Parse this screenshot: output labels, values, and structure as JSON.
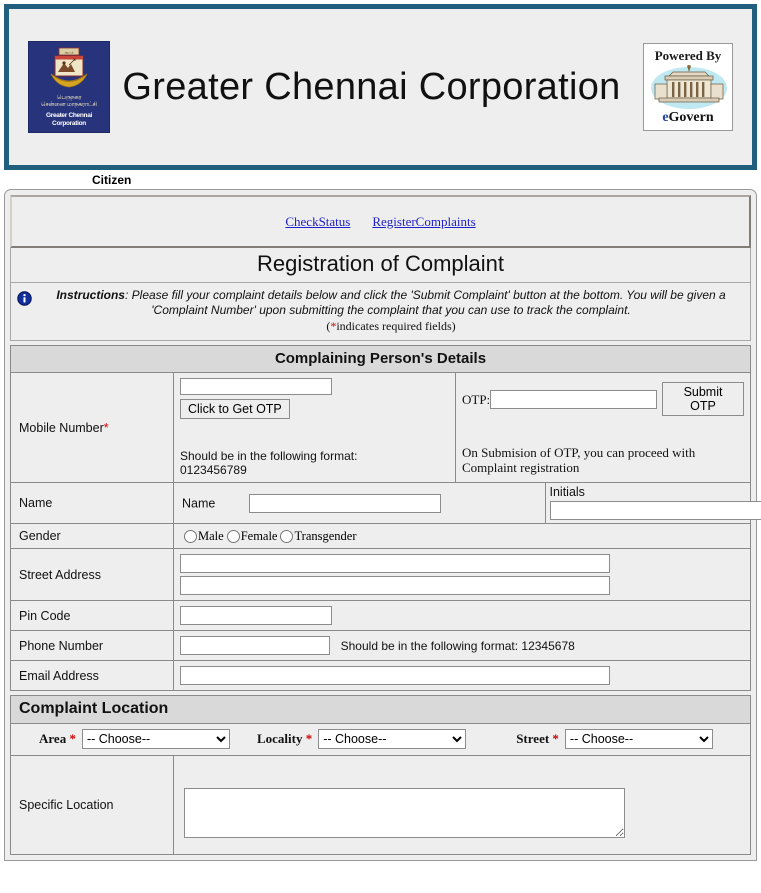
{
  "header": {
    "title": "Greater Chennai Corporation",
    "gcc_logo": {
      "icon": "chennai-corporation-crest",
      "tamil_line1": "பெருநகர",
      "tamil_line2": "சென்னை மாநகராட்சி",
      "english": "Greater Chennai Corporation"
    },
    "egovern_logo": {
      "top_text": "Powered By",
      "icon": "government-building-icon",
      "brand_prefix": "e",
      "brand_suffix": "Govern"
    },
    "accent_color": "#215f7f"
  },
  "citizen_label": "Citizen",
  "nav": {
    "links": [
      {
        "label": "CheckStatus"
      },
      {
        "label": "RegisterComplaints"
      }
    ]
  },
  "page_title": "Registration of Complaint",
  "instructions": {
    "icon": "info-icon",
    "heading": "Instructions",
    "body": ": Please fill your complaint details below and click the 'Submit Complaint' button at the bottom. You will  be given a 'Complaint Number' upon submitting the complaint that you can use to track the complaint.",
    "required_note_open": "(",
    "required_note_star": "*",
    "required_note_text": "indicates required fields)"
  },
  "person_section": {
    "heading": "Complaining Person's Details",
    "mobile": {
      "label": "Mobile Number",
      "required": "*",
      "value": "",
      "placeholder": "",
      "get_otp_button": "Click to Get OTP",
      "format_hint_line1": "Should be in the following format:",
      "format_hint_line2": "0123456789",
      "otp_label": "OTP:",
      "otp_value": "",
      "submit_otp_button": "Submit OTP",
      "otp_note": "On Submision of OTP, you can proceed with Complaint registration"
    },
    "name": {
      "label": "Name",
      "inner_label": "Name",
      "value": "",
      "initials_label": "Initials",
      "initials_value": ""
    },
    "gender": {
      "label": "Gender",
      "options": [
        "Male",
        "Female",
        "Transgender"
      ],
      "selected": ""
    },
    "street_address": {
      "label": "Street Address",
      "line1": "",
      "line2": ""
    },
    "pin_code": {
      "label": "Pin Code",
      "value": ""
    },
    "phone": {
      "label": "Phone Number",
      "value": "",
      "hint": "Should be in the following format: 12345678"
    },
    "email": {
      "label": "Email Address",
      "value": ""
    }
  },
  "location_section": {
    "heading": "Complaint Location",
    "area": {
      "label": "Area",
      "required": "*",
      "selected": "-- Choose--",
      "options": [
        "-- Choose--"
      ]
    },
    "locality": {
      "label": "Locality",
      "required": "*",
      "selected": "-- Choose--",
      "options": [
        "-- Choose--"
      ]
    },
    "street": {
      "label": "Street",
      "required": "*",
      "selected": "-- Choose--",
      "options": [
        "-- Choose--"
      ]
    },
    "specific_location": {
      "label": "Specific Location",
      "value": ""
    }
  }
}
